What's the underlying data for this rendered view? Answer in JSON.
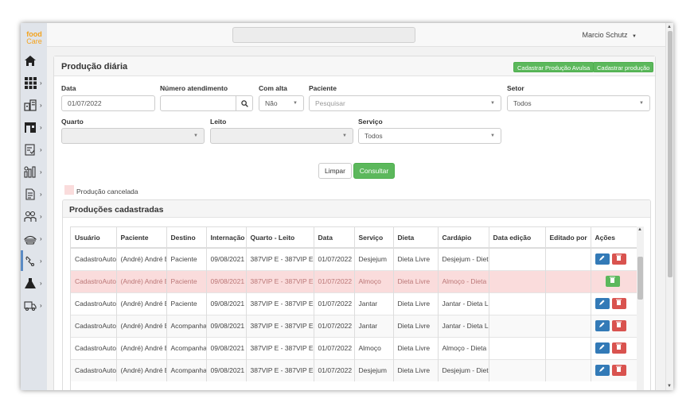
{
  "brand": {
    "line1": "food",
    "line2": "Care"
  },
  "sidebar": {
    "items": [
      {
        "icon": "home-icon"
      },
      {
        "icon": "grid-icon"
      },
      {
        "icon": "building-icon"
      },
      {
        "icon": "store-icon"
      },
      {
        "icon": "clipboard-icon"
      },
      {
        "icon": "chart-icon"
      },
      {
        "icon": "document-icon"
      },
      {
        "icon": "people-icon"
      },
      {
        "icon": "food-icon"
      },
      {
        "icon": "nutrition-icon"
      },
      {
        "icon": "flask-icon"
      },
      {
        "icon": "truck-icon"
      }
    ]
  },
  "header": {
    "user_name": "Marcio Schutz"
  },
  "page": {
    "title": "Produção diária",
    "btn_avulsa": "Cadastrar Produção Avulsa",
    "btn_cadastrar": "Cadastrar produção"
  },
  "filters": {
    "data_label": "Data",
    "data_value": "01/07/2022",
    "atendimento_label": "Número atendimento",
    "atendimento_value": "",
    "alta_label": "Com alta",
    "alta_value": "Não",
    "paciente_label": "Paciente",
    "paciente_placeholder": "Pesquisar",
    "setor_label": "Setor",
    "setor_value": "Todos",
    "quarto_label": "Quarto",
    "leito_label": "Leito",
    "servico_label": "Serviço",
    "servico_value": "Todos"
  },
  "actions": {
    "limpar": "Limpar",
    "consultar": "Consultar"
  },
  "legend": {
    "cancelled": "Produção cancelada",
    "cancelled_color": "#fadcdc"
  },
  "table": {
    "title": "Produções cadastradas",
    "columns": [
      "Usuário",
      "Paciente",
      "Destino",
      "Internação",
      "Quarto - Leito",
      "Data",
      "Serviço",
      "Dieta",
      "Cardápio",
      "Data edição",
      "Editado por",
      "Ações"
    ],
    "rows": [
      {
        "usuario": "CadastroAuto",
        "paciente": "(André) André E",
        "destino": "Paciente",
        "internacao": "09/08/2021",
        "quarto": "387VIP E - 387VIP E",
        "data": "01/07/2022",
        "servico": "Desjejum",
        "dieta": "Dieta Livre",
        "cardapio": "Desjejum - Diet",
        "data_edicao": "",
        "editado_por": "",
        "cancelled": false
      },
      {
        "usuario": "CadastroAuto",
        "paciente": "(André) André E",
        "destino": "Paciente",
        "internacao": "09/08/2021",
        "quarto": "387VIP E - 387VIP E",
        "data": "01/07/2022",
        "servico": "Almoço",
        "dieta": "Dieta Livre",
        "cardapio": "Almoço - Dieta",
        "data_edicao": "",
        "editado_por": "",
        "cancelled": true
      },
      {
        "usuario": "CadastroAuto",
        "paciente": "(André) André E",
        "destino": "Paciente",
        "internacao": "09/08/2021",
        "quarto": "387VIP E - 387VIP E",
        "data": "01/07/2022",
        "servico": "Jantar",
        "dieta": "Dieta Livre",
        "cardapio": "Jantar - Dieta L",
        "data_edicao": "",
        "editado_por": "",
        "cancelled": false
      },
      {
        "usuario": "CadastroAuto",
        "paciente": "(André) André E",
        "destino": "Acompanha",
        "internacao": "09/08/2021",
        "quarto": "387VIP E - 387VIP E",
        "data": "01/07/2022",
        "servico": "Jantar",
        "dieta": "Dieta Livre",
        "cardapio": "Jantar - Dieta L",
        "data_edicao": "",
        "editado_por": "",
        "cancelled": false
      },
      {
        "usuario": "CadastroAuto",
        "paciente": "(André) André E",
        "destino": "Acompanha",
        "internacao": "09/08/2021",
        "quarto": "387VIP E - 387VIP E",
        "data": "01/07/2022",
        "servico": "Almoço",
        "dieta": "Dieta Livre",
        "cardapio": "Almoço - Dieta",
        "data_edicao": "",
        "editado_por": "",
        "cancelled": false
      },
      {
        "usuario": "CadastroAuto",
        "paciente": "(André) André E",
        "destino": "Acompanha",
        "internacao": "09/08/2021",
        "quarto": "387VIP E - 387VIP E",
        "data": "01/07/2022",
        "servico": "Desjejum",
        "dieta": "Dieta Livre",
        "cardapio": "Desjejum - Diet",
        "data_edicao": "",
        "editado_por": "",
        "cancelled": false
      }
    ]
  },
  "colors": {
    "accent_green": "#5cb85c",
    "edit_blue": "#337ab7",
    "delete_red": "#d9534f",
    "brand_orange": "#f4a21b"
  }
}
